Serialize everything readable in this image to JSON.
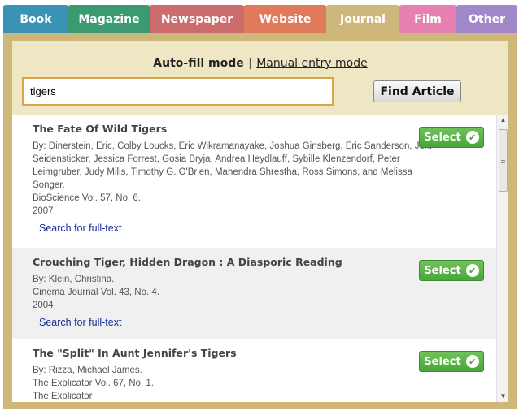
{
  "tabs": [
    {
      "label": "Book",
      "color": "#3a93b5"
    },
    {
      "label": "Magazine",
      "color": "#3b9a72"
    },
    {
      "label": "Newspaper",
      "color": "#cc6b6b"
    },
    {
      "label": "Website",
      "color": "#e07a5a"
    },
    {
      "label": "Journal",
      "color": "#cdb77a",
      "active": true
    },
    {
      "label": "Film",
      "color": "#e77fb0"
    },
    {
      "label": "Other",
      "color": "#a287c9"
    }
  ],
  "modes": {
    "auto": "Auto-fill mode",
    "separator": "|",
    "manual": "Manual entry mode"
  },
  "search": {
    "value": "tigers",
    "button": "Find Article"
  },
  "select_label": "Select",
  "fulltext_label": "Search for full-text",
  "results": [
    {
      "title": "The Fate Of Wild Tigers",
      "authors": "By: Dinerstein, Eric, Colby Loucks, Eric Wikramanayake, Joshua Ginsberg, Eric Sanderson, John Seidensticker, Jessica Forrest, Gosia Bryja, Andrea Heydlauff, Sybille Klenzendorf, Peter Leimgruber, Judy Mills, Timothy G. O'Brien, Mahendra Shrestha, Ross Simons, and Melissa Songer.",
      "source": "BioScience Vol. 57, No. 6.",
      "year": "2007"
    },
    {
      "title": "Crouching Tiger, Hidden Dragon : A Diasporic Reading",
      "authors": "By: Klein, Christina.",
      "source": "Cinema Journal Vol. 43, No. 4.",
      "year": "2004"
    },
    {
      "title": "The \"Split\" In Aunt Jennifer's Tigers",
      "authors": "By: Rizza, Michael James.",
      "source": "The Explicator Vol. 67, No. 1.",
      "year": "The Explicator"
    }
  ]
}
